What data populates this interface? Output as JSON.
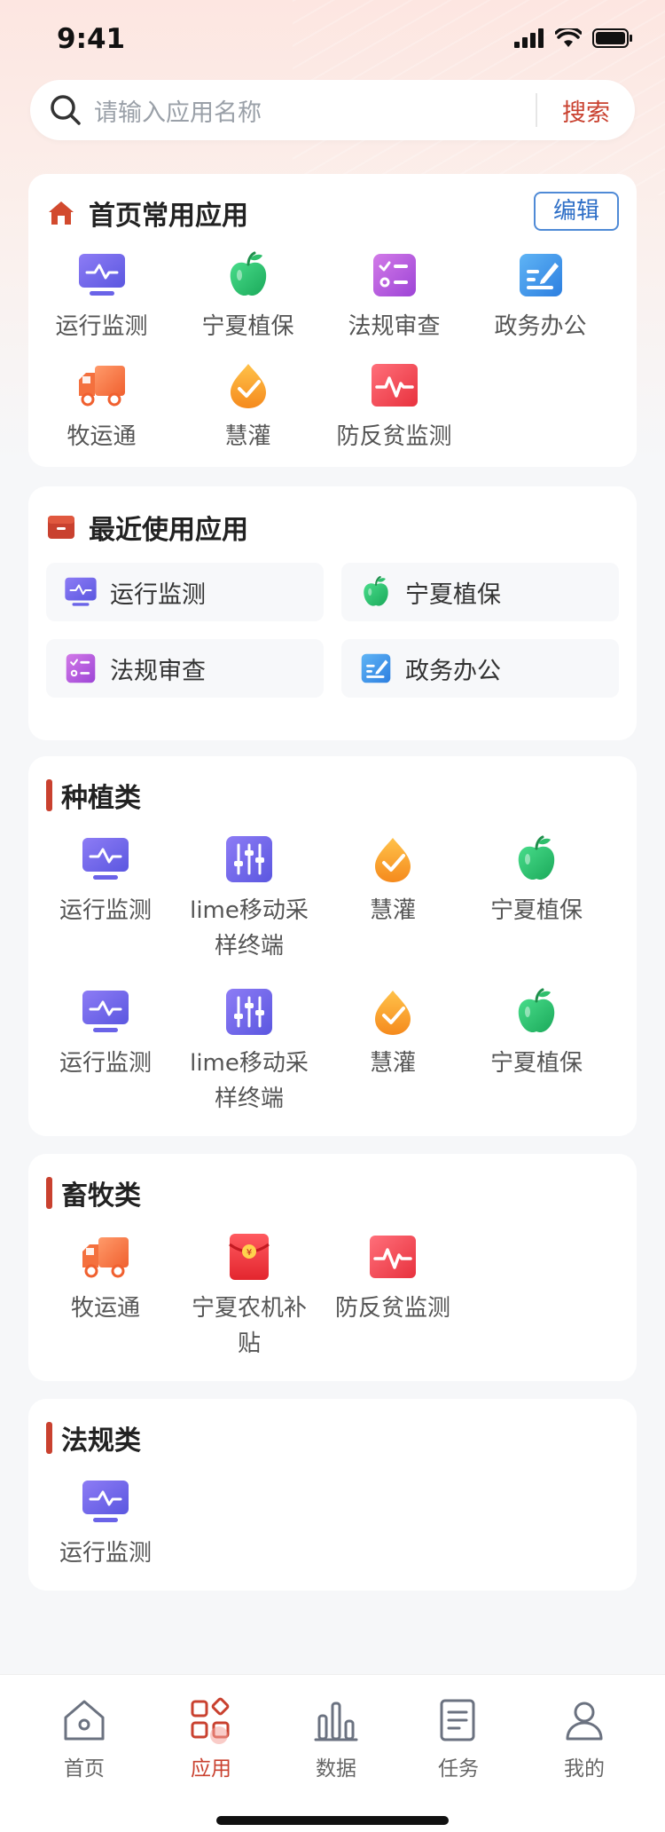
{
  "status": {
    "time": "9:41"
  },
  "search": {
    "placeholder": "请输入应用名称",
    "button": "搜索"
  },
  "common": {
    "title": "首页常用应用",
    "edit": "编辑",
    "items": [
      {
        "label": "运行监测",
        "icon": "monitor-icon"
      },
      {
        "label": "宁夏植保",
        "icon": "apple-icon"
      },
      {
        "label": "法规审查",
        "icon": "checklist-icon"
      },
      {
        "label": "政务办公",
        "icon": "edit-doc-icon"
      },
      {
        "label": "牧运通",
        "icon": "truck-icon"
      },
      {
        "label": "慧灌",
        "icon": "drop-check-icon"
      },
      {
        "label": "防反贫监测",
        "icon": "pulse-icon"
      }
    ]
  },
  "recent": {
    "title": "最近使用应用",
    "items": [
      {
        "label": "运行监测",
        "icon": "monitor-icon"
      },
      {
        "label": "宁夏植保",
        "icon": "apple-icon"
      },
      {
        "label": "法规审查",
        "icon": "checklist-icon"
      },
      {
        "label": "政务办公",
        "icon": "edit-doc-icon"
      }
    ]
  },
  "planting": {
    "title": "种植类",
    "items": [
      {
        "label": "运行监测",
        "icon": "monitor-icon"
      },
      {
        "label": "lime移动采样终端",
        "icon": "sliders-icon"
      },
      {
        "label": "慧灌",
        "icon": "drop-check-icon"
      },
      {
        "label": "宁夏植保",
        "icon": "apple-icon"
      },
      {
        "label": "运行监测",
        "icon": "monitor-icon"
      },
      {
        "label": "lime移动采样终端",
        "icon": "sliders-icon"
      },
      {
        "label": "慧灌",
        "icon": "drop-check-icon"
      },
      {
        "label": "宁夏植保",
        "icon": "apple-icon"
      }
    ]
  },
  "livestock": {
    "title": "畜牧类",
    "items": [
      {
        "label": "牧运通",
        "icon": "truck-icon"
      },
      {
        "label": "宁夏农机补贴",
        "icon": "red-envelope-icon"
      },
      {
        "label": "防反贫监测",
        "icon": "pulse-icon"
      }
    ]
  },
  "law": {
    "title": "法规类",
    "items": [
      {
        "label": "运行监测",
        "icon": "monitor-icon"
      }
    ]
  },
  "tabs": [
    {
      "label": "首页",
      "icon": "home-icon"
    },
    {
      "label": "应用",
      "icon": "apps-icon",
      "active": true
    },
    {
      "label": "数据",
      "icon": "bar-chart-icon"
    },
    {
      "label": "任务",
      "icon": "task-doc-icon"
    },
    {
      "label": "我的",
      "icon": "user-icon"
    }
  ]
}
